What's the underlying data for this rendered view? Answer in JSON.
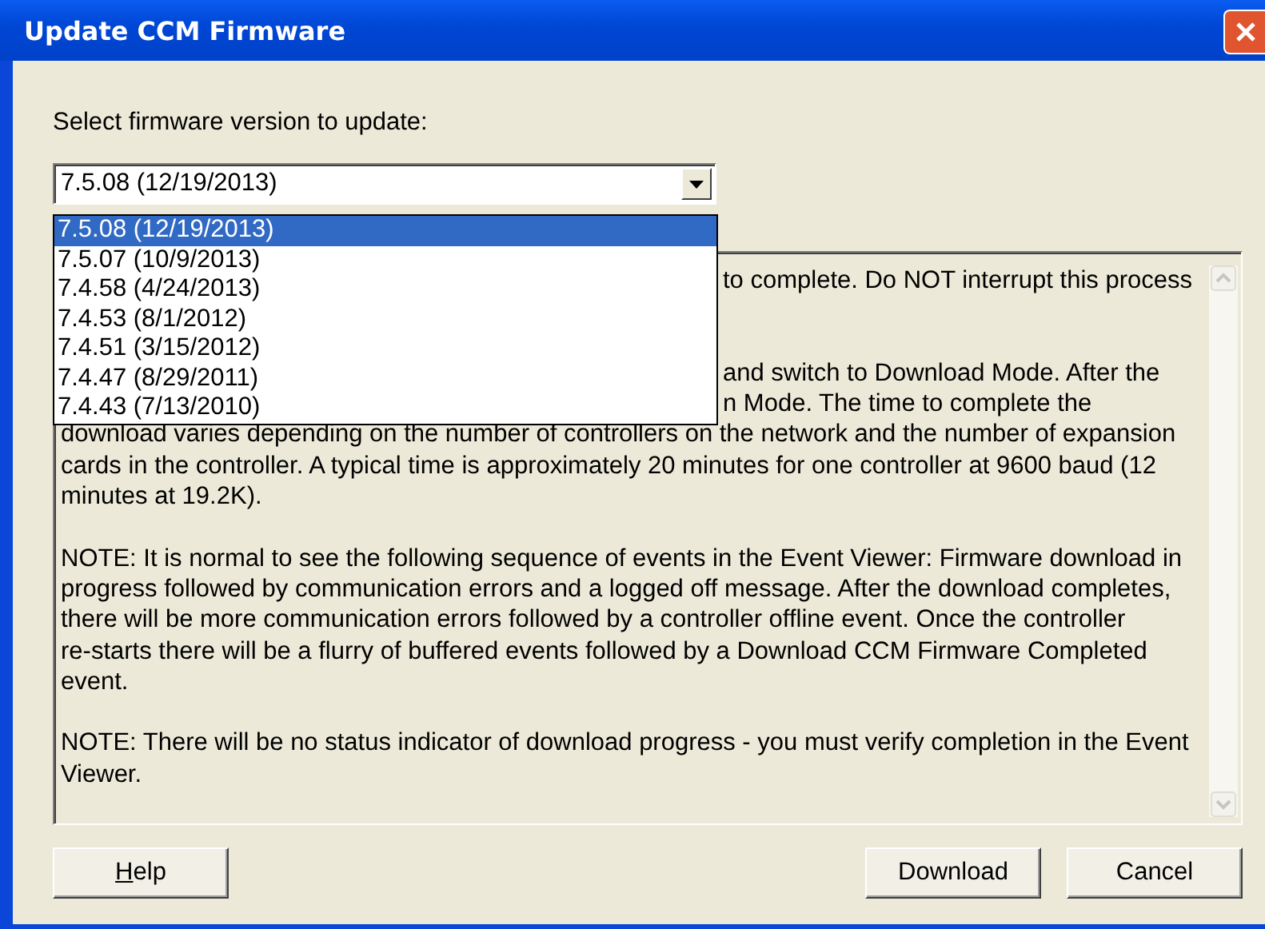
{
  "window": {
    "title": "Update CCM Firmware"
  },
  "prompt": "Select firmware version to update:",
  "version_combo": {
    "value": "7.5.08 (12/19/2013)",
    "expanded": true,
    "options": [
      {
        "label": "7.5.08 (12/19/2013)",
        "selected": true
      },
      {
        "label": "7.5.07 (10/9/2013)",
        "selected": false
      },
      {
        "label": "7.4.58 (4/24/2013)",
        "selected": false
      },
      {
        "label": "7.4.53 (8/1/2012)",
        "selected": false
      },
      {
        "label": "7.4.51 (3/15/2012)",
        "selected": false
      },
      {
        "label": "7.4.47 (8/29/2011)",
        "selected": false
      },
      {
        "label": "7.4.43 (7/13/2010)",
        "selected": false
      }
    ]
  },
  "notes": {
    "lines": [
      {
        "kind": "fragment",
        "text": "to complete. Do NOT interrupt this process"
      },
      {
        "kind": "blank"
      },
      {
        "kind": "blank"
      },
      {
        "kind": "fragment",
        "text": "and switch to Download Mode. After the"
      },
      {
        "kind": "fragment",
        "text": "n Mode. The time to complete the"
      },
      {
        "kind": "full",
        "text": "download varies depending on the number of controllers on the network and the number of expansion"
      },
      {
        "kind": "full",
        "text": "cards in the controller. A typical time is approximately 20 minutes for one controller at 9600 baud (12"
      },
      {
        "kind": "full",
        "text": "minutes at 19.2K)."
      },
      {
        "kind": "blank"
      },
      {
        "kind": "full",
        "text": "NOTE: It is normal to see the following sequence of events in the Event Viewer: Firmware download in"
      },
      {
        "kind": "full",
        "text": "progress followed by communication errors and a logged off message. After the download completes,"
      },
      {
        "kind": "full",
        "text": "there will be more communication errors followed by a controller offline event. Once the controller"
      },
      {
        "kind": "full",
        "text": "re-starts there will be a flurry of buffered events followed by a Download CCM Firmware Completed"
      },
      {
        "kind": "full",
        "text": "event."
      },
      {
        "kind": "blank"
      },
      {
        "kind": "full",
        "text": "NOTE: There will be no status indicator of download progress - you must verify completion in the Event"
      },
      {
        "kind": "full",
        "text": "Viewer."
      }
    ]
  },
  "buttons": [
    {
      "label": "Help",
      "mnemonic_first": true
    },
    {
      "label": "Download",
      "mnemonic_first": false
    },
    {
      "label": "Cancel",
      "mnemonic_first": false
    }
  ]
}
